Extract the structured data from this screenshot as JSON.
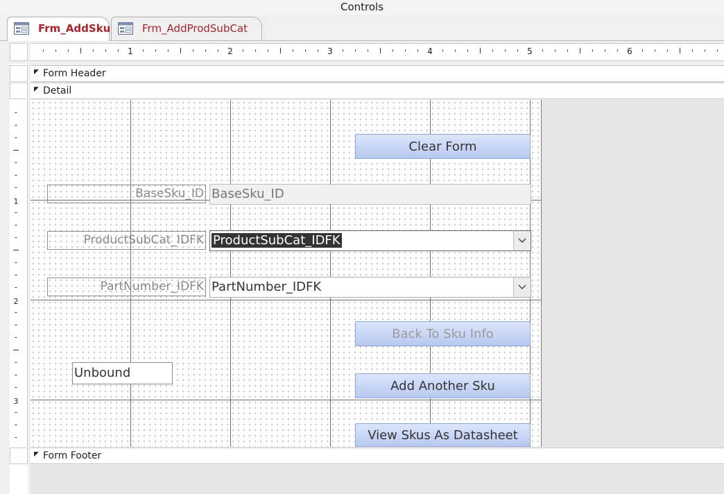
{
  "window": {
    "title": "Controls"
  },
  "tabs": [
    {
      "label": "Frm_AddSku",
      "active": true
    },
    {
      "label": "Frm_AddProdSubCat",
      "active": false
    }
  ],
  "ruler": {
    "top_marks": [
      "1",
      "2",
      "3",
      "4",
      "5",
      "6"
    ],
    "left_marks": [
      "1",
      "2",
      "3"
    ]
  },
  "sections": {
    "header": "Form Header",
    "detail": "Detail",
    "footer": "Form Footer"
  },
  "buttons": {
    "clear_form": "Clear Form",
    "back_to_sku_info": "Back To Sku Info",
    "add_another_sku": "Add Another Sku",
    "view_skus_datasheet": "View Skus As Datasheet"
  },
  "fields": {
    "basesku": {
      "label": "BaseSku_ID",
      "value": "BaseSku_ID"
    },
    "productsubcat": {
      "label": "ProductSubCat_IDFK",
      "value": "ProductSubCat_IDFK"
    },
    "partnumber": {
      "label": "PartNumber_IDFK",
      "value": "PartNumber_IDFK"
    },
    "unbound": {
      "value": "Unbound"
    }
  },
  "colors": {
    "accent_tab_text": "#a4262c",
    "button_fill": "#b8c9f0"
  }
}
